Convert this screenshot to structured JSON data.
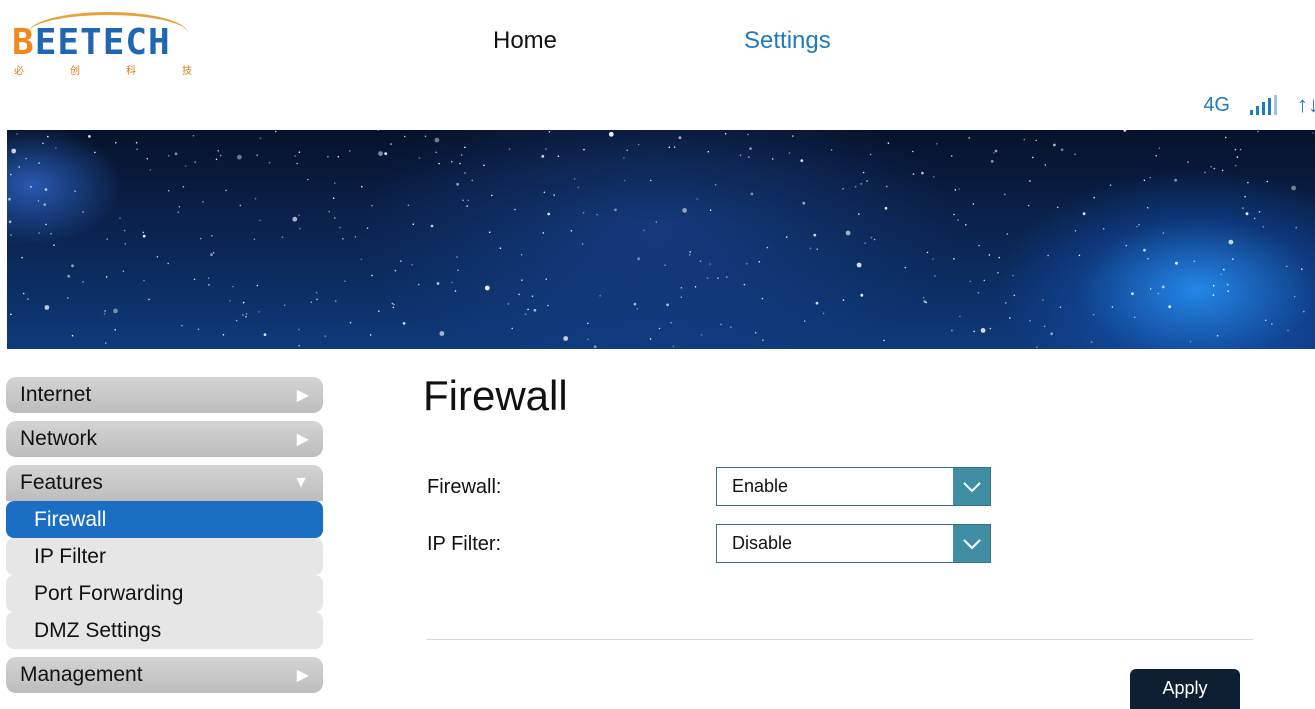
{
  "brand": {
    "logo_first": "B",
    "logo_rest": "EETECH",
    "logo_chars": [
      "必",
      "创",
      "科",
      "技"
    ],
    "orange": "#f08a1c",
    "blue": "#1f67b3"
  },
  "nav": {
    "home": "Home",
    "settings": "Settings",
    "active": "Settings"
  },
  "status": {
    "network": "4G",
    "signal_icon": "signal-bars-icon",
    "data_icon": "up-down-arrows-icon"
  },
  "sidebar": {
    "categories": [
      {
        "label": "Internet",
        "expanded": false
      },
      {
        "label": "Network",
        "expanded": false
      },
      {
        "label": "Features",
        "expanded": true,
        "items": [
          "Firewall",
          "IP Filter",
          "Port Forwarding",
          "DMZ Settings"
        ],
        "active_item": "Firewall"
      },
      {
        "label": "Management",
        "expanded": false
      }
    ],
    "accent": "#1a6fc5"
  },
  "main": {
    "title": "Firewall",
    "fields": [
      {
        "label": "Firewall:",
        "value": "Enable"
      },
      {
        "label": "IP Filter:",
        "value": "Disable"
      }
    ],
    "apply_label": "Apply"
  }
}
